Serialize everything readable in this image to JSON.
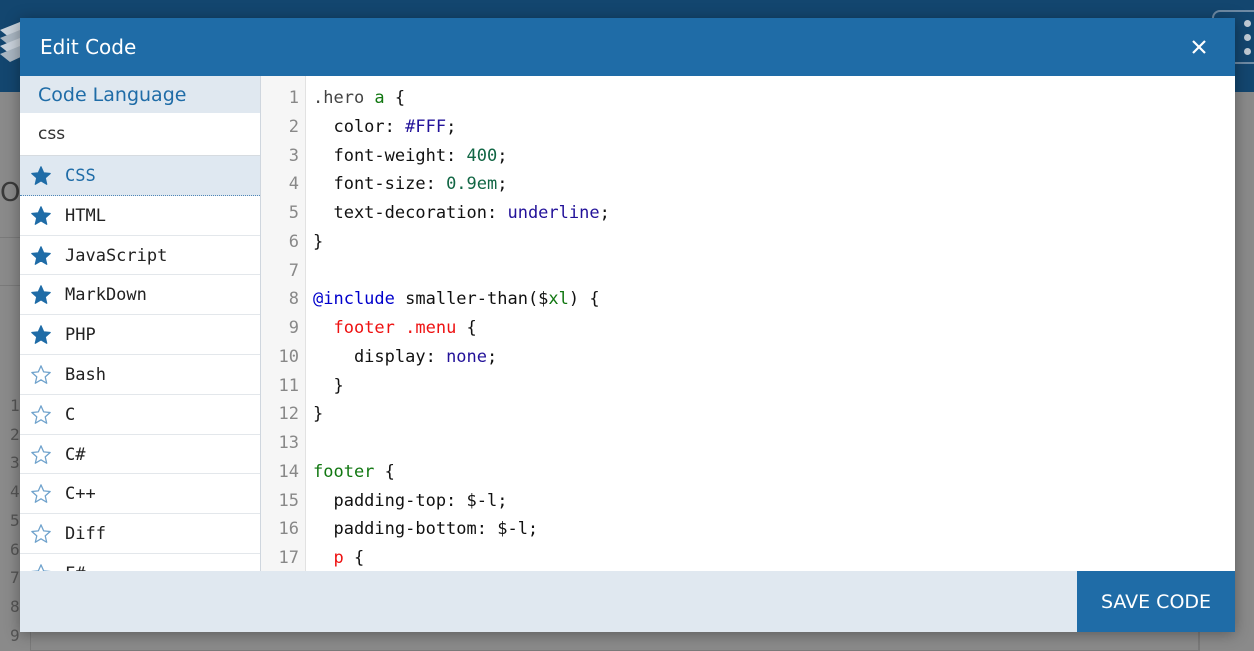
{
  "modal": {
    "title": "Edit Code",
    "close_icon": "close-icon",
    "save_label": "SAVE CODE"
  },
  "language_pane": {
    "header": "Code Language",
    "search_value": "css",
    "items": [
      {
        "label": "CSS",
        "starred": true,
        "selected": true
      },
      {
        "label": "HTML",
        "starred": true,
        "selected": false
      },
      {
        "label": "JavaScript",
        "starred": true,
        "selected": false
      },
      {
        "label": "MarkDown",
        "starred": true,
        "selected": false
      },
      {
        "label": "PHP",
        "starred": true,
        "selected": false
      },
      {
        "label": "Bash",
        "starred": false,
        "selected": false
      },
      {
        "label": "C",
        "starred": false,
        "selected": false
      },
      {
        "label": "C#",
        "starred": false,
        "selected": false
      },
      {
        "label": "C++",
        "starred": false,
        "selected": false
      },
      {
        "label": "Diff",
        "starred": false,
        "selected": false
      },
      {
        "label": "F#",
        "starred": false,
        "selected": false
      }
    ]
  },
  "editor": {
    "lines": [
      {
        "num": "1",
        "tokens": [
          {
            "t": ".hero ",
            "c": "sel"
          },
          {
            "t": "a",
            "c": "tag"
          },
          {
            "t": " {",
            "c": "plain"
          }
        ]
      },
      {
        "num": "2",
        "tokens": [
          {
            "t": "  color: ",
            "c": "plain"
          },
          {
            "t": "#FFF",
            "c": "hex"
          },
          {
            "t": ";",
            "c": "plain"
          }
        ]
      },
      {
        "num": "3",
        "tokens": [
          {
            "t": "  font-weight: ",
            "c": "plain"
          },
          {
            "t": "400",
            "c": "num"
          },
          {
            "t": ";",
            "c": "plain"
          }
        ]
      },
      {
        "num": "4",
        "tokens": [
          {
            "t": "  font-size: ",
            "c": "plain"
          },
          {
            "t": "0.9em",
            "c": "num"
          },
          {
            "t": ";",
            "c": "plain"
          }
        ]
      },
      {
        "num": "5",
        "tokens": [
          {
            "t": "  text-decoration: ",
            "c": "plain"
          },
          {
            "t": "underline",
            "c": "kw"
          },
          {
            "t": ";",
            "c": "plain"
          }
        ]
      },
      {
        "num": "6",
        "tokens": [
          {
            "t": "}",
            "c": "plain"
          }
        ]
      },
      {
        "num": "7",
        "tokens": []
      },
      {
        "num": "8",
        "tokens": [
          {
            "t": "@include",
            "c": "at"
          },
          {
            "t": " smaller-than($",
            "c": "plain"
          },
          {
            "t": "xl",
            "c": "var"
          },
          {
            "t": ") {",
            "c": "plain"
          }
        ]
      },
      {
        "num": "9",
        "tokens": [
          {
            "t": "  ",
            "c": "plain"
          },
          {
            "t": "footer .menu",
            "c": "red"
          },
          {
            "t": " {",
            "c": "plain"
          }
        ]
      },
      {
        "num": "10",
        "tokens": [
          {
            "t": "    display: ",
            "c": "plain"
          },
          {
            "t": "none",
            "c": "kw"
          },
          {
            "t": ";",
            "c": "plain"
          }
        ]
      },
      {
        "num": "11",
        "tokens": [
          {
            "t": "  }",
            "c": "plain"
          }
        ]
      },
      {
        "num": "12",
        "tokens": [
          {
            "t": "}",
            "c": "plain"
          }
        ]
      },
      {
        "num": "13",
        "tokens": []
      },
      {
        "num": "14",
        "tokens": [
          {
            "t": "footer",
            "c": "tag"
          },
          {
            "t": " {",
            "c": "plain"
          }
        ]
      },
      {
        "num": "15",
        "tokens": [
          {
            "t": "  padding-top: $-l;",
            "c": "plain"
          }
        ]
      },
      {
        "num": "16",
        "tokens": [
          {
            "t": "  padding-bottom: $-l;",
            "c": "plain"
          }
        ]
      },
      {
        "num": "17",
        "tokens": [
          {
            "t": "  ",
            "c": "plain"
          },
          {
            "t": "p",
            "c": "red"
          },
          {
            "t": " {",
            "c": "plain"
          }
        ]
      }
    ]
  },
  "colors": {
    "header_blue": "#1f6ca7",
    "pane_header_bg": "#e0e8f0",
    "star": "#1f6ca7"
  }
}
